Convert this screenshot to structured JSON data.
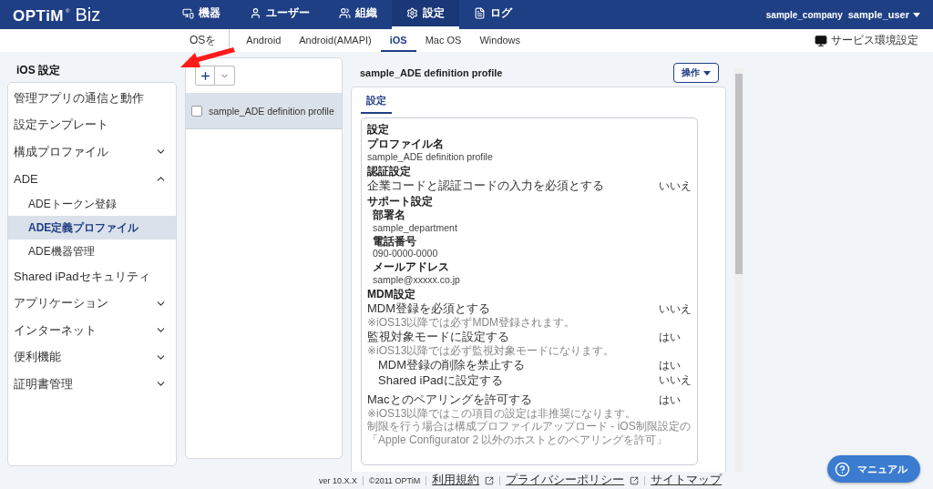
{
  "header": {
    "logo": {
      "brand": "OPTiM",
      "mark": "®",
      "product": "Biz"
    },
    "nav": [
      {
        "label": "機器",
        "selected": false
      },
      {
        "label": "ユーザー",
        "selected": false
      },
      {
        "label": "組織",
        "selected": false
      },
      {
        "label": "設定",
        "selected": true
      },
      {
        "label": "ログ",
        "selected": false
      }
    ],
    "company": "sample_company",
    "user": "sample_user"
  },
  "subnav": {
    "os_label": "OSを",
    "tabs": [
      {
        "label": "Android",
        "selected": false
      },
      {
        "label": "Android(AMAPI)",
        "selected": false
      },
      {
        "label": "iOS",
        "selected": true
      },
      {
        "label": "Mac OS",
        "selected": false
      },
      {
        "label": "Windows",
        "selected": false
      }
    ],
    "service_settings": "サービス環境設定"
  },
  "sidebar": {
    "title": "iOS 設定",
    "items": [
      {
        "label": "管理アプリの通信と動作",
        "kind": "link",
        "selected": false
      },
      {
        "label": "設定テンプレート",
        "kind": "link",
        "selected": false
      },
      {
        "label": "構成プロファイル",
        "kind": "group",
        "expanded": false,
        "selected": false
      },
      {
        "label": "ADE",
        "kind": "group",
        "expanded": true,
        "selected": false,
        "children": [
          {
            "label": "ADEトークン登録",
            "selected": false
          },
          {
            "label": "ADE定義プロファイル",
            "selected": true
          },
          {
            "label": "ADE機器管理",
            "selected": false
          }
        ]
      },
      {
        "label": "Shared iPadセキュリティ",
        "kind": "link",
        "selected": false
      },
      {
        "label": "アプリケーション",
        "kind": "group",
        "expanded": false,
        "selected": false
      },
      {
        "label": "インターネット",
        "kind": "group",
        "expanded": false,
        "selected": false
      },
      {
        "label": "便利機能",
        "kind": "group",
        "expanded": false,
        "selected": false
      },
      {
        "label": "証明書管理",
        "kind": "group",
        "expanded": false,
        "selected": false
      }
    ]
  },
  "profile_list": {
    "items": [
      {
        "label": "sample_ADE definition profile",
        "checked": false,
        "selected": true
      }
    ]
  },
  "detail": {
    "title": "sample_ADE definition profile",
    "action_button": "操作",
    "tabs": [
      {
        "label": "設定",
        "selected": true
      }
    ],
    "section_title": "設定",
    "sections": [
      {
        "heading": "プロファイル名",
        "rows": [
          {
            "kind": "value",
            "text": "sample_ADE definition profile"
          }
        ]
      },
      {
        "heading": "認証設定",
        "rows": [
          {
            "kind": "setting",
            "label": "企業コードと認証コードの入力を必須とする",
            "answer": "いいえ"
          }
        ]
      },
      {
        "heading": "サポート設定",
        "rows": [
          {
            "kind": "field",
            "label": "部署名",
            "value": "sample_department"
          },
          {
            "kind": "field",
            "label": "電話番号",
            "value": "090-0000-0000"
          },
          {
            "kind": "field",
            "label": "メールアドレス",
            "value": "sample@xxxxx.co.jp"
          }
        ]
      },
      {
        "heading": "MDM設定",
        "rows": [
          {
            "kind": "setting",
            "label": "MDM登録を必須とする",
            "answer": "いいえ",
            "notes": [
              "※iOS13以降では必ずMDM登録されます。"
            ]
          },
          {
            "kind": "setting",
            "label": "監視対象モードに設定する",
            "answer": "はい",
            "notes": [
              "※iOS13以降では必ず監視対象モードになります。"
            ],
            "children": [
              {
                "kind": "setting",
                "label": "MDM登録の削除を禁止する",
                "answer": "はい"
              },
              {
                "kind": "setting",
                "label": "Shared iPadに設定する",
                "answer": "いいえ"
              }
            ]
          },
          {
            "kind": "setting",
            "label": "Macとのペアリングを許可する",
            "answer": "はい",
            "notes": [
              "※iOS13以降ではこの項目の設定は非推奨になります。",
              "制限を行う場合は構成プロファイルアップロード - iOS制限設定の",
              "「Apple Configurator 2 以外のホストとのペアリングを許可」"
            ]
          }
        ]
      }
    ]
  },
  "footer": {
    "version": "ver 10.X.X",
    "copyright": "©2011 OPTiM",
    "links": [
      {
        "label": "利用規約",
        "external": true
      },
      {
        "label": "プライバシーポリシー",
        "external": true
      },
      {
        "label": "サイトマップ",
        "external": false
      }
    ]
  },
  "manual_button": "マニュアル"
}
